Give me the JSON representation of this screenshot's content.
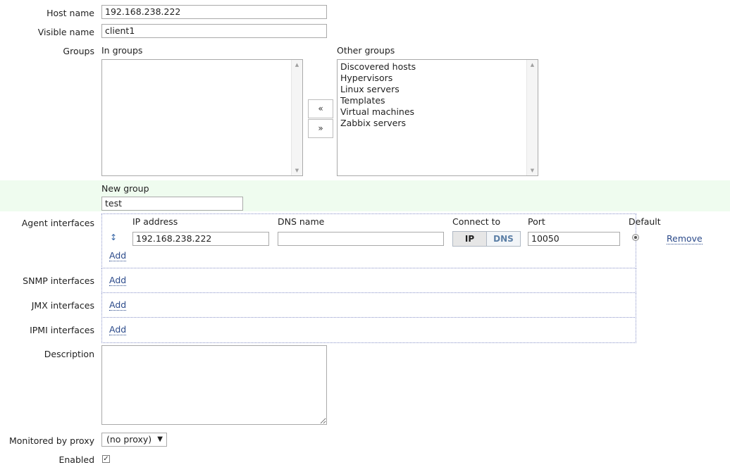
{
  "form": {
    "host_name": {
      "label": "Host name",
      "value": "192.168.238.222"
    },
    "visible_name": {
      "label": "Visible name",
      "value": "client1"
    },
    "groups": {
      "label": "Groups",
      "in_groups_label": "In groups",
      "in_groups": [],
      "other_groups_label": "Other groups",
      "other_groups": [
        "Discovered hosts",
        "Hypervisors",
        "Linux servers",
        "Templates",
        "Virtual machines",
        "Zabbix servers"
      ],
      "move_left": "«",
      "move_right": "»"
    },
    "new_group": {
      "label": "New group",
      "value": "test"
    },
    "agent_interfaces": {
      "label": "Agent interfaces",
      "columns": {
        "ip": "IP address",
        "dns": "DNS name",
        "connect": "Connect to",
        "port": "Port",
        "default": "Default"
      },
      "row": {
        "ip": "192.168.238.222",
        "dns": "",
        "connect_ip": "IP",
        "connect_dns": "DNS",
        "port": "10050",
        "remove": "Remove"
      },
      "add": "Add"
    },
    "snmp_interfaces": {
      "label": "SNMP interfaces",
      "add": "Add"
    },
    "jmx_interfaces": {
      "label": "JMX interfaces",
      "add": "Add"
    },
    "ipmi_interfaces": {
      "label": "IPMI interfaces",
      "add": "Add"
    },
    "description": {
      "label": "Description",
      "value": ""
    },
    "proxy": {
      "label": "Monitored by proxy",
      "value": "(no proxy)"
    },
    "enabled": {
      "label": "Enabled",
      "checked": true
    }
  }
}
